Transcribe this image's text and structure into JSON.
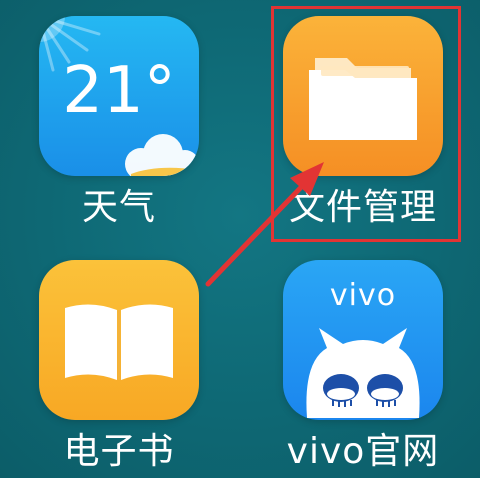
{
  "apps": [
    {
      "label": "天气",
      "icon": "weather-icon",
      "temperature": "21°"
    },
    {
      "label": "文件管理",
      "icon": "folder-icon"
    },
    {
      "label": "电子书",
      "icon": "book-icon"
    },
    {
      "label": "vivo官网",
      "icon": "vivo-mascot-icon",
      "brand_text": "vivo"
    }
  ],
  "highlight": {
    "target": "文件管理",
    "color": "#e23434"
  },
  "colors": {
    "background": "#0e6a76",
    "weather": "#1fa3ee",
    "files": "#f8a12d",
    "ebook": "#fab630",
    "vivo": "#2196f0"
  }
}
